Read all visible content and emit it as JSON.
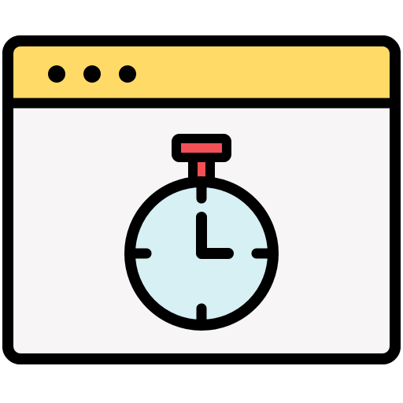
{
  "icon": {
    "subject": "browser-window-stopwatch-icon",
    "window_controls": [
      "dot-icon",
      "dot-icon",
      "dot-icon"
    ],
    "content_icon": "stopwatch-icon"
  },
  "colors": {
    "outline": "#000000",
    "titlebar": "#FFDA66",
    "window_body": "#F7F5F6",
    "clock_face": "#D6F0F4",
    "stopwatch_button": "#F05056",
    "stopwatch_stem": "#F05056"
  }
}
